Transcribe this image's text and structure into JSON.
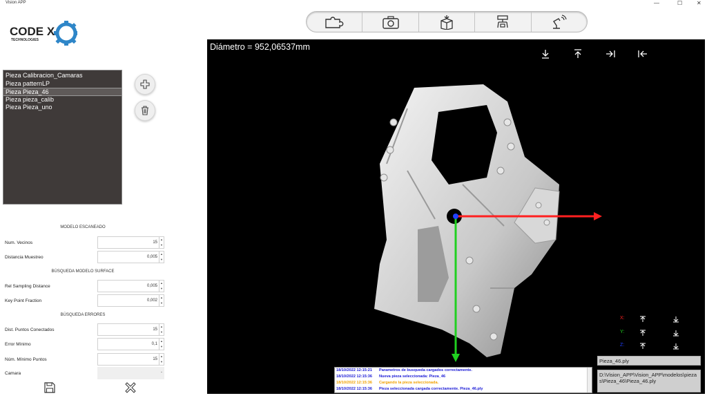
{
  "window": {
    "title": "Vision APP",
    "controls": [
      "—",
      "☐",
      "✕"
    ]
  },
  "logo": {
    "name": "CODE X",
    "subtitle": "TECHNOLOGIES"
  },
  "toolbar": {
    "buttons": [
      {
        "name": "puzzle-icon"
      },
      {
        "name": "camera-icon"
      },
      {
        "name": "box-icon"
      },
      {
        "name": "robot-gripper-icon"
      },
      {
        "name": "robot-arm-wireless-icon"
      }
    ]
  },
  "pieces": {
    "items": [
      "Pieza Calibracion_Camaras",
      "Pieza patternLP",
      "Pieza Pieza_46",
      "Pieza pieza_calib",
      "Pieza Pieza_uno"
    ],
    "selected_index": 2
  },
  "params": {
    "scanned_model_title": "MODELO ESCANEADO",
    "num_neighbors_label": "Num. Vecinos",
    "num_neighbors_value": "15",
    "sampling_distance_label": "Distancia Muestreo",
    "sampling_distance_value": "0,005",
    "surface_search_title": "BÚSQUEDA MODELO SURFACE",
    "rel_sampling_label": "Rel Sampling Distance",
    "rel_sampling_value": "0,005",
    "key_point_label": "Key Point Fraction",
    "key_point_value": "0,002",
    "error_search_title": "BÚSQUEDA ERRORES",
    "connected_points_label": "Dist. Puntos Conectados",
    "connected_points_value": "15",
    "min_error_label": "Error Mínimo",
    "min_error_value": "0,1",
    "min_points_label": "Núm. Mínimo Puntos",
    "min_points_value": "15",
    "camera_label": "Camara",
    "camera_value": "-"
  },
  "viewer": {
    "diameter_text": "Diámetro = 952,06537mm",
    "axis_x_label": "X:",
    "axis_y_label": "Y:",
    "axis_z_label": "Z:",
    "axis_x_color": "#ff2020",
    "axis_y_color": "#20d020",
    "axis_z_color": "#2040ff",
    "file_name": "Pieza_46.ply",
    "file_path": "D:\\Vision_APP\\Vision_APP\\modelos\\piezas\\Pieza_46\\Pieza_46.ply"
  },
  "log": {
    "lines": [
      {
        "time": "18/10/2022 12:15:21",
        "text": "Parametros de busqueda cargados correctamente.",
        "color": "#1a1ad6"
      },
      {
        "time": "18/10/2022 12:15:36",
        "text": "Nueva pieza seleccionada: Pieza_46",
        "color": "#1a1ad6"
      },
      {
        "time": "18/10/2022 12:15:36",
        "text": "Cargando la pieza seleccionada.",
        "color": "#f0a000"
      },
      {
        "time": "18/10/2022 12:15:36",
        "text": "Pieza seleccionada cargada correctamente. Pieza_46.ply",
        "color": "#1a1ad6"
      }
    ]
  },
  "colors": {
    "list_bg": "#3f3a39",
    "viewer_bg": "#000000",
    "logo_gear": "#2e86c8"
  }
}
